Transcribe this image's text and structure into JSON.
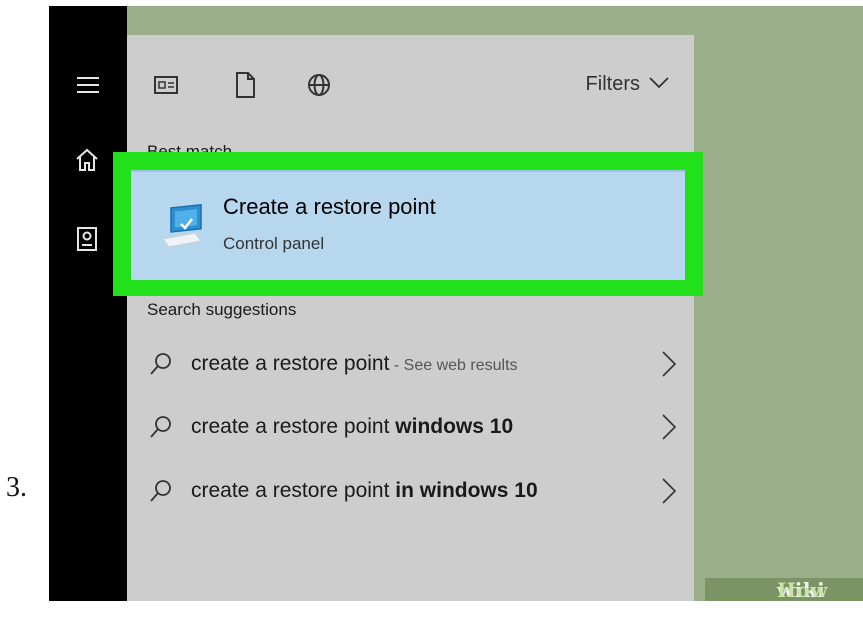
{
  "step_number": "3.",
  "toolbar": {
    "filters_label": "Filters"
  },
  "sections": {
    "best_match": "Best match",
    "search_suggestions": "Search suggestions"
  },
  "best_match": {
    "title": "Create a restore point",
    "subtitle": "Control panel"
  },
  "suggestions": [
    {
      "prefix": "create a restore point",
      "bold": "",
      "suffix": " - See web results"
    },
    {
      "prefix": "create a restore point ",
      "bold": "windows 10",
      "suffix": ""
    },
    {
      "prefix": "create a restore point ",
      "bold": "in windows 10",
      "suffix": ""
    }
  ],
  "watermark": {
    "part1": "wiki",
    "part2": "How"
  },
  "colors": {
    "highlight": "#22e01a",
    "selected": "#b7d7ef",
    "rail": "#000000",
    "panel": "#cdcdcd",
    "background": "#9aae8a"
  },
  "icons": [
    "hamburger-menu-icon",
    "home-icon",
    "contact-card-icon",
    "apps-icon",
    "document-icon",
    "globe-icon",
    "chevron-down-icon",
    "control-panel-icon",
    "search-icon",
    "chevron-right-icon"
  ]
}
